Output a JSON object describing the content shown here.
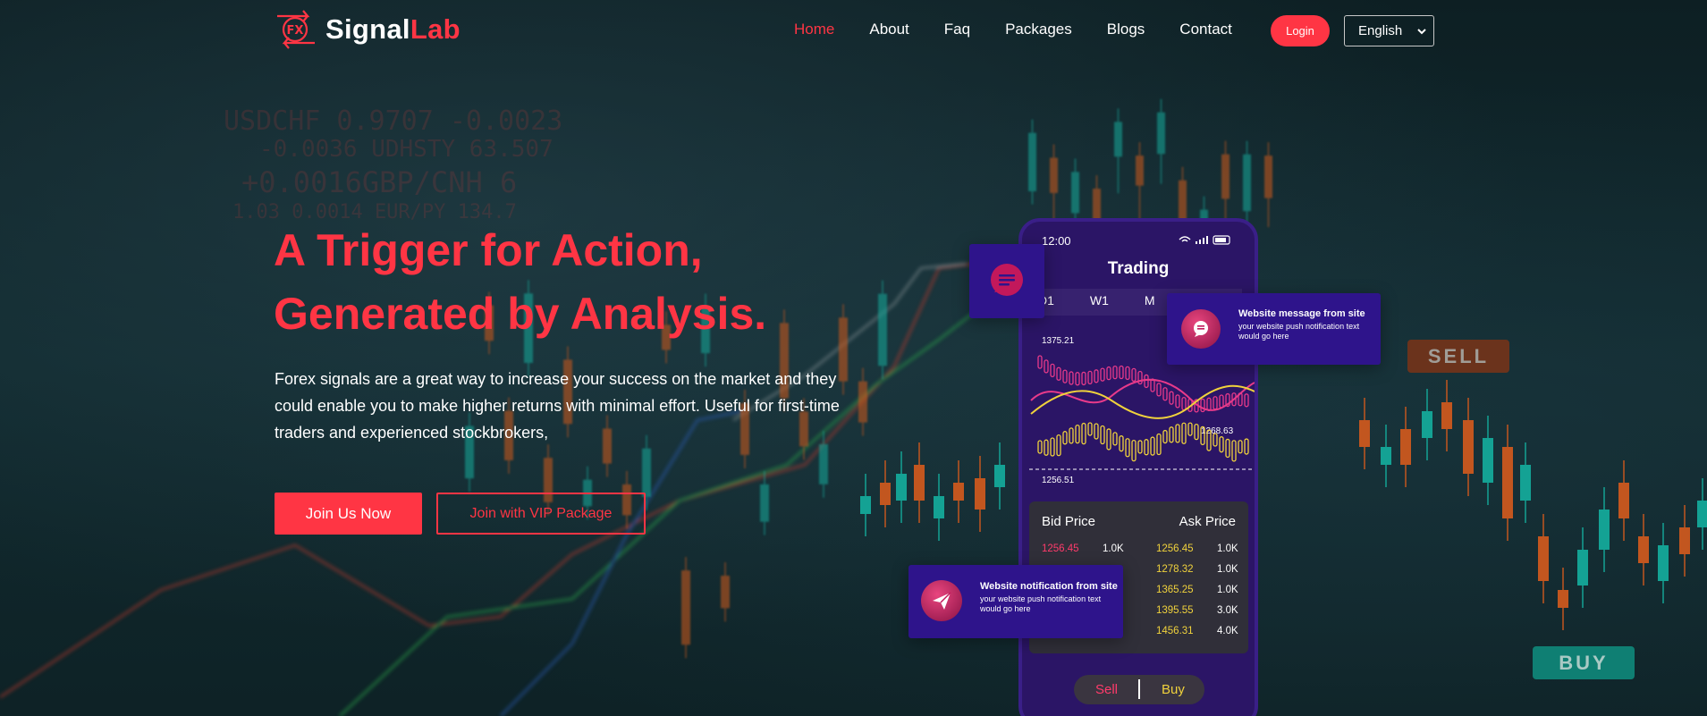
{
  "brand": {
    "logo_mark": "FX",
    "name_white": "Signal",
    "name_red": "Lab"
  },
  "nav": {
    "items": [
      {
        "label": "Home",
        "active": true
      },
      {
        "label": "About"
      },
      {
        "label": "Faq"
      },
      {
        "label": "Packages"
      },
      {
        "label": "Blogs"
      },
      {
        "label": "Contact"
      }
    ],
    "login_label": "Login",
    "language": "English"
  },
  "hero": {
    "title_line1": "A Trigger for Action,",
    "title_line2": "Generated by Analysis.",
    "description": "Forex signals are a great way to increase your success on the market and they could enable you to make higher returns with minimal effort. Useful for first-time traders and experienced stockbrokers,",
    "primary_button": "Join Us Now",
    "secondary_button": "Join with VIP Package"
  },
  "phone": {
    "time": "12:00",
    "title": "Trading",
    "tabs": [
      "D1",
      "W1",
      "M"
    ],
    "price_high": "1375.21",
    "price_mid": "1268.63",
    "price_low": "1256.51",
    "book": {
      "bid_header": "Bid Price",
      "ask_header": "Ask Price",
      "rows": [
        {
          "bid": "1256.45",
          "bid_qty": "1.0K",
          "ask": "1256.45",
          "ask_qty": "1.0K"
        },
        {
          "bid": "",
          "bid_qty": "",
          "ask": "1278.32",
          "ask_qty": "1.0K"
        },
        {
          "bid": "",
          "bid_qty": "",
          "ask": "1365.25",
          "ask_qty": "1.0K"
        },
        {
          "bid": "",
          "bid_qty": "",
          "ask": "1395.55",
          "ask_qty": "3.0K"
        },
        {
          "bid": "",
          "bid_qty": "",
          "ask": "1456.31",
          "ask_qty": "4.0K"
        }
      ]
    },
    "sell_label": "Sell",
    "buy_label": "Buy"
  },
  "notifications": {
    "message": {
      "title": "Website message from site",
      "body": "your website push notification text would go here"
    },
    "notification": {
      "title": "Website notification from site",
      "body": "your website push notification text would go here"
    }
  },
  "tags": {
    "sell": "SELL",
    "buy": "BUY"
  },
  "colors": {
    "accent": "#ff3544",
    "phone_bg": "#2b1566",
    "buy_tag": "#0f8c7e",
    "sell_tag": "#b84a22"
  }
}
